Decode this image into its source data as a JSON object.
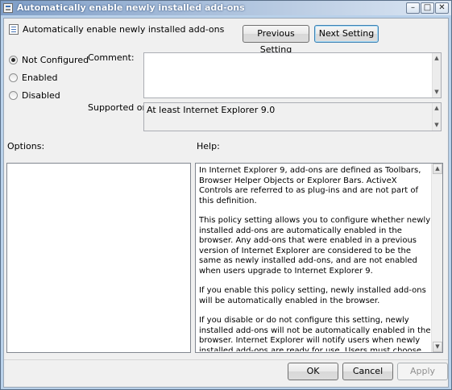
{
  "window": {
    "title": "Automatically enable newly installed add-ons",
    "minimize_glyph": "–",
    "maximize_glyph": "□",
    "close_glyph": "✕"
  },
  "header": {
    "title": "Automatically enable newly installed add-ons",
    "previous_label": "Previous Setting",
    "next_label": "Next Setting"
  },
  "state_options": [
    {
      "label": "Not Configured",
      "selected": true
    },
    {
      "label": "Enabled",
      "selected": false
    },
    {
      "label": "Disabled",
      "selected": false
    }
  ],
  "comment": {
    "label": "Comment:",
    "value": ""
  },
  "supported": {
    "label": "Supported on:",
    "value": "At least Internet Explorer 9.0"
  },
  "options": {
    "label": "Options:"
  },
  "help": {
    "label": "Help:",
    "paragraphs": [
      "In Internet Explorer 9, add-ons are defined as Toolbars, Browser Helper Objects or Explorer Bars. ActiveX Controls are referred to as plug-ins and are not part of this definition.",
      "This policy setting allows you to configure whether newly installed add-ons are automatically enabled in the browser. Any add-ons that were enabled in a previous version of Internet Explorer are considered to be the same as newly installed add-ons, and are not enabled when users upgrade to Internet Explorer 9.",
      "If you enable this policy setting, newly installed add-ons will be automatically enabled in the browser.",
      "If you disable or do not configure this setting, newly installed add-ons will not be automatically enabled in the browser. Internet Explorer will notify users when newly installed add-ons are ready for use. Users must choose to enable them by responding to the notification, using Manage Add-ons, or using other existing methods."
    ]
  },
  "footer": {
    "ok_label": "OK",
    "cancel_label": "Cancel",
    "apply_label": "Apply"
  }
}
